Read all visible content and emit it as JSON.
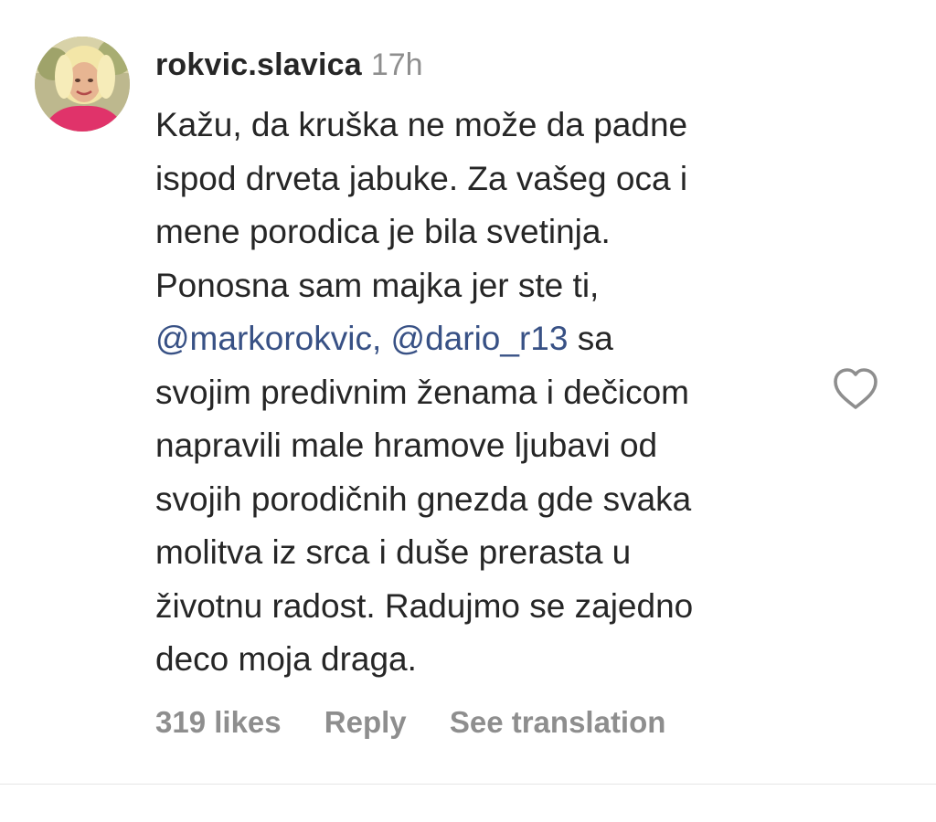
{
  "comment": {
    "username": "rokvic.slavica",
    "time_ago": "17h",
    "text": {
      "line1": "Kažu, da kruška ne može da padne",
      "line2": "ispod drveta jabuke. Za vašeg oca i",
      "line3": "mene porodica je bila svetinja.",
      "line4": "Ponosna sam majka jer ste ti,",
      "mention1": "@markorokvic,",
      "mention2": "@dario_r13",
      "line5_tail": "sa",
      "line6": "svojim predivnim ženama i dečicom",
      "line7": "napravili male hramove ljubavi od",
      "line8": "svojih porodičnih gnezda gde svaka",
      "line9": "molitva iz srca i duše prerasta u",
      "line10": "životnu radost. Radujmo se zajedno",
      "line11": "deco moja draga."
    },
    "likes_label": "319 likes",
    "reply_label": "Reply",
    "translation_label": "See translation",
    "like_icon": "heart-outline-icon",
    "colors": {
      "text": "#262626",
      "muted": "#8e8e8e",
      "mention": "#385185"
    }
  }
}
